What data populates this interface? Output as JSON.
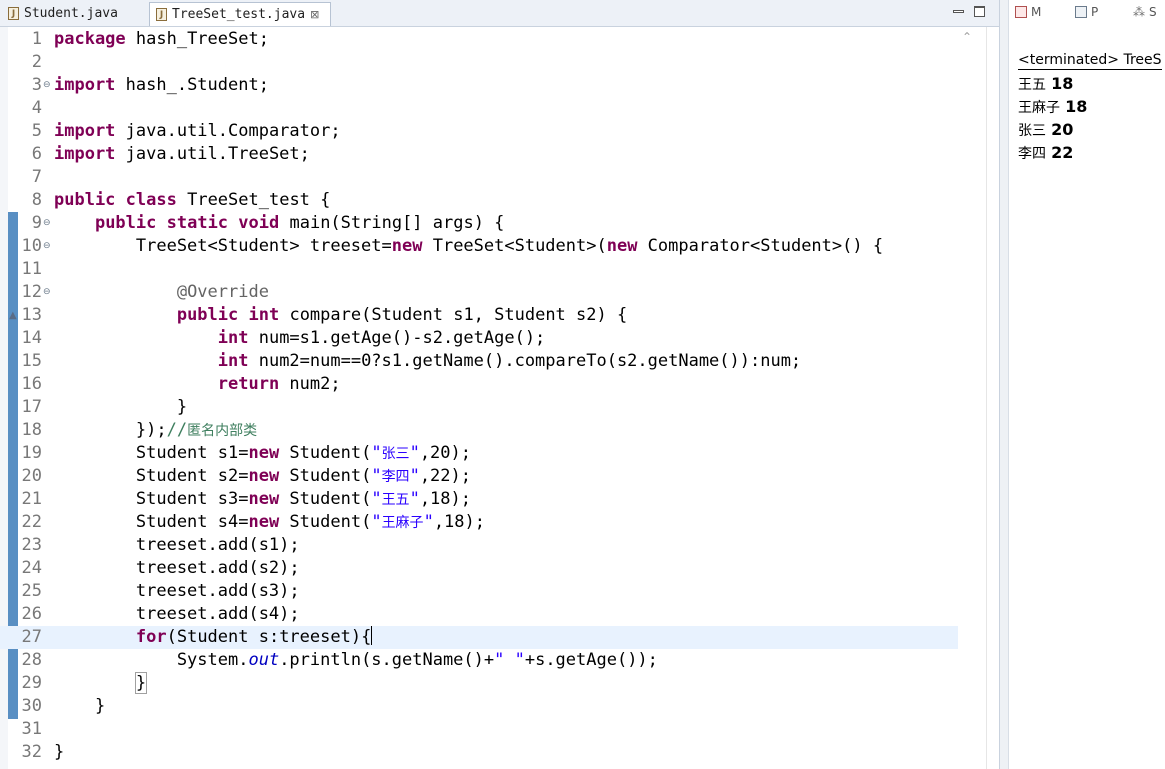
{
  "editor": {
    "tabs": [
      {
        "label": "Student.java",
        "active": false
      },
      {
        "label": "TreeSet_test.java",
        "active": true,
        "close": "⊠"
      }
    ],
    "lines": [
      {
        "n": "1",
        "tokens": [
          {
            "t": "package",
            "c": "kw"
          },
          {
            "t": " hash_TreeSet;"
          }
        ]
      },
      {
        "n": "2",
        "tokens": []
      },
      {
        "n": "3",
        "fold": "⊖",
        "tokens": [
          {
            "t": "import",
            "c": "kw"
          },
          {
            "t": " hash_.Student;"
          }
        ]
      },
      {
        "n": "4",
        "tokens": []
      },
      {
        "n": "5",
        "tokens": [
          {
            "t": "import",
            "c": "kw"
          },
          {
            "t": " java.util.Comparator;"
          }
        ]
      },
      {
        "n": "6",
        "tokens": [
          {
            "t": "import",
            "c": "kw"
          },
          {
            "t": " java.util.TreeSet;"
          }
        ]
      },
      {
        "n": "7",
        "tokens": []
      },
      {
        "n": "8",
        "tokens": [
          {
            "t": "public",
            "c": "kw"
          },
          {
            "t": " "
          },
          {
            "t": "class",
            "c": "kw"
          },
          {
            "t": " TreeSet_test {"
          }
        ]
      },
      {
        "n": "9",
        "fold": "⊖",
        "tokens": [
          {
            "t": "    "
          },
          {
            "t": "public",
            "c": "kw"
          },
          {
            "t": " "
          },
          {
            "t": "static",
            "c": "kw"
          },
          {
            "t": " "
          },
          {
            "t": "void",
            "c": "kw"
          },
          {
            "t": " main(String[] args) {"
          }
        ]
      },
      {
        "n": "10",
        "fold": "⊖",
        "tokens": [
          {
            "t": "        TreeSet<Student> treeset="
          },
          {
            "t": "new",
            "c": "kw"
          },
          {
            "t": " TreeSet<Student>("
          },
          {
            "t": "new",
            "c": "kw"
          },
          {
            "t": " Comparator<Student>() {"
          }
        ]
      },
      {
        "n": "11",
        "tokens": []
      },
      {
        "n": "12",
        "fold": "⊖",
        "tokens": [
          {
            "t": "            "
          },
          {
            "t": "@Override",
            "c": "ann"
          }
        ]
      },
      {
        "n": "13",
        "ovr": "▲",
        "tokens": [
          {
            "t": "            "
          },
          {
            "t": "public",
            "c": "kw"
          },
          {
            "t": " "
          },
          {
            "t": "int",
            "c": "kw"
          },
          {
            "t": " compare(Student s1, Student s2) {"
          }
        ]
      },
      {
        "n": "14",
        "tokens": [
          {
            "t": "                "
          },
          {
            "t": "int",
            "c": "kw"
          },
          {
            "t": " num=s1.getAge()-s2.getAge();"
          }
        ]
      },
      {
        "n": "15",
        "tokens": [
          {
            "t": "                "
          },
          {
            "t": "int",
            "c": "kw"
          },
          {
            "t": " num2=num==0?s1.getName().compareTo(s2.getName()):num;"
          }
        ]
      },
      {
        "n": "16",
        "tokens": [
          {
            "t": "                "
          },
          {
            "t": "return",
            "c": "kw"
          },
          {
            "t": " num2;"
          }
        ]
      },
      {
        "n": "17",
        "tokens": [
          {
            "t": "            }"
          }
        ]
      },
      {
        "n": "18",
        "tokens": [
          {
            "t": "        });"
          },
          {
            "t": "//",
            "c": "cmt"
          },
          {
            "t": "匿名内部类",
            "c": "cmt cjk"
          }
        ]
      },
      {
        "n": "19",
        "tokens": [
          {
            "t": "        Student s1="
          },
          {
            "t": "new",
            "c": "kw"
          },
          {
            "t": " Student("
          },
          {
            "t": "\"",
            "c": "str"
          },
          {
            "t": "张三",
            "c": "str cjk"
          },
          {
            "t": "\"",
            "c": "str"
          },
          {
            "t": ",20);"
          }
        ]
      },
      {
        "n": "20",
        "tokens": [
          {
            "t": "        Student s2="
          },
          {
            "t": "new",
            "c": "kw"
          },
          {
            "t": " Student("
          },
          {
            "t": "\"",
            "c": "str"
          },
          {
            "t": "李四",
            "c": "str cjk"
          },
          {
            "t": "\"",
            "c": "str"
          },
          {
            "t": ",22);"
          }
        ]
      },
      {
        "n": "21",
        "tokens": [
          {
            "t": "        Student s3="
          },
          {
            "t": "new",
            "c": "kw"
          },
          {
            "t": " Student("
          },
          {
            "t": "\"",
            "c": "str"
          },
          {
            "t": "王五",
            "c": "str cjk"
          },
          {
            "t": "\"",
            "c": "str"
          },
          {
            "t": ",18);"
          }
        ]
      },
      {
        "n": "22",
        "tokens": [
          {
            "t": "        Student s4="
          },
          {
            "t": "new",
            "c": "kw"
          },
          {
            "t": " Student("
          },
          {
            "t": "\"",
            "c": "str"
          },
          {
            "t": "王麻子",
            "c": "str cjk"
          },
          {
            "t": "\"",
            "c": "str"
          },
          {
            "t": ",18);"
          }
        ]
      },
      {
        "n": "23",
        "tokens": [
          {
            "t": "        treeset.add(s1);"
          }
        ]
      },
      {
        "n": "24",
        "tokens": [
          {
            "t": "        treeset.add(s2);"
          }
        ]
      },
      {
        "n": "25",
        "tokens": [
          {
            "t": "        treeset.add(s3);"
          }
        ]
      },
      {
        "n": "26",
        "tokens": [
          {
            "t": "        treeset.add(s4);"
          }
        ]
      },
      {
        "n": "27",
        "current": true,
        "tokens": [
          {
            "t": "        "
          },
          {
            "t": "for",
            "c": "kw"
          },
          {
            "t": "(Student s:treeset){"
          },
          {
            "t": "",
            "c": "cursor"
          }
        ]
      },
      {
        "n": "28",
        "tokens": [
          {
            "t": "            System."
          },
          {
            "t": "out",
            "c": "fld"
          },
          {
            "t": ".println(s.getName()+"
          },
          {
            "t": "\" \"",
            "c": "str"
          },
          {
            "t": "+s.getAge());"
          }
        ]
      },
      {
        "n": "29",
        "tokens": [
          {
            "t": "        "
          },
          {
            "t": "}",
            "c": "bracket"
          }
        ]
      },
      {
        "n": "30",
        "tokens": [
          {
            "t": "    }"
          }
        ]
      },
      {
        "n": "31",
        "tokens": []
      },
      {
        "n": "32",
        "tokens": [
          {
            "t": "}"
          }
        ]
      }
    ],
    "scroll_up": "⌃"
  },
  "console": {
    "tabs": [
      {
        "icon": "markers-icon",
        "label": "M"
      },
      {
        "icon": "properties-icon",
        "label": "P"
      },
      {
        "icon": "servers-icon",
        "label": "S",
        "glyph": "⁂"
      }
    ],
    "terminated": "<terminated> TreeS",
    "output": [
      {
        "name": "王五",
        "age": "18"
      },
      {
        "name": "王麻子",
        "age": "18"
      },
      {
        "name": "张三",
        "age": "20"
      },
      {
        "name": "李四",
        "age": "22"
      }
    ]
  }
}
